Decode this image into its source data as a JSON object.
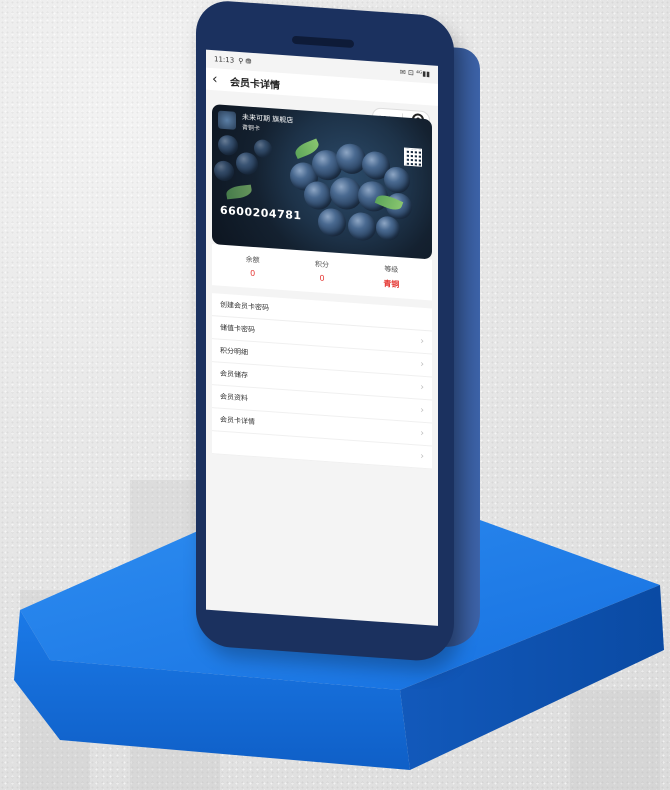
{
  "status_bar": {
    "time": "11:13",
    "signal": "⚲ ⛃",
    "indicators": "✉ ⊡ ⁴ᴳ▮▮"
  },
  "nav": {
    "title": "会员卡详情"
  },
  "capsule": {
    "more_label": "•••"
  },
  "card": {
    "shop_name": "未来可期 旗舰店",
    "level_text": "青铜卡",
    "number": "6600204781"
  },
  "stats": [
    {
      "label": "余额",
      "value": "0"
    },
    {
      "label": "积分",
      "value": "0"
    },
    {
      "label": "等级",
      "value": "青铜"
    }
  ],
  "list": {
    "header": "创建会员卡密码",
    "items": [
      {
        "label": "储值卡密码"
      },
      {
        "label": "积分明细"
      },
      {
        "label": "会员储存"
      },
      {
        "label": "会员资料"
      },
      {
        "label": "会员卡详情"
      },
      {
        "label": ""
      }
    ]
  }
}
